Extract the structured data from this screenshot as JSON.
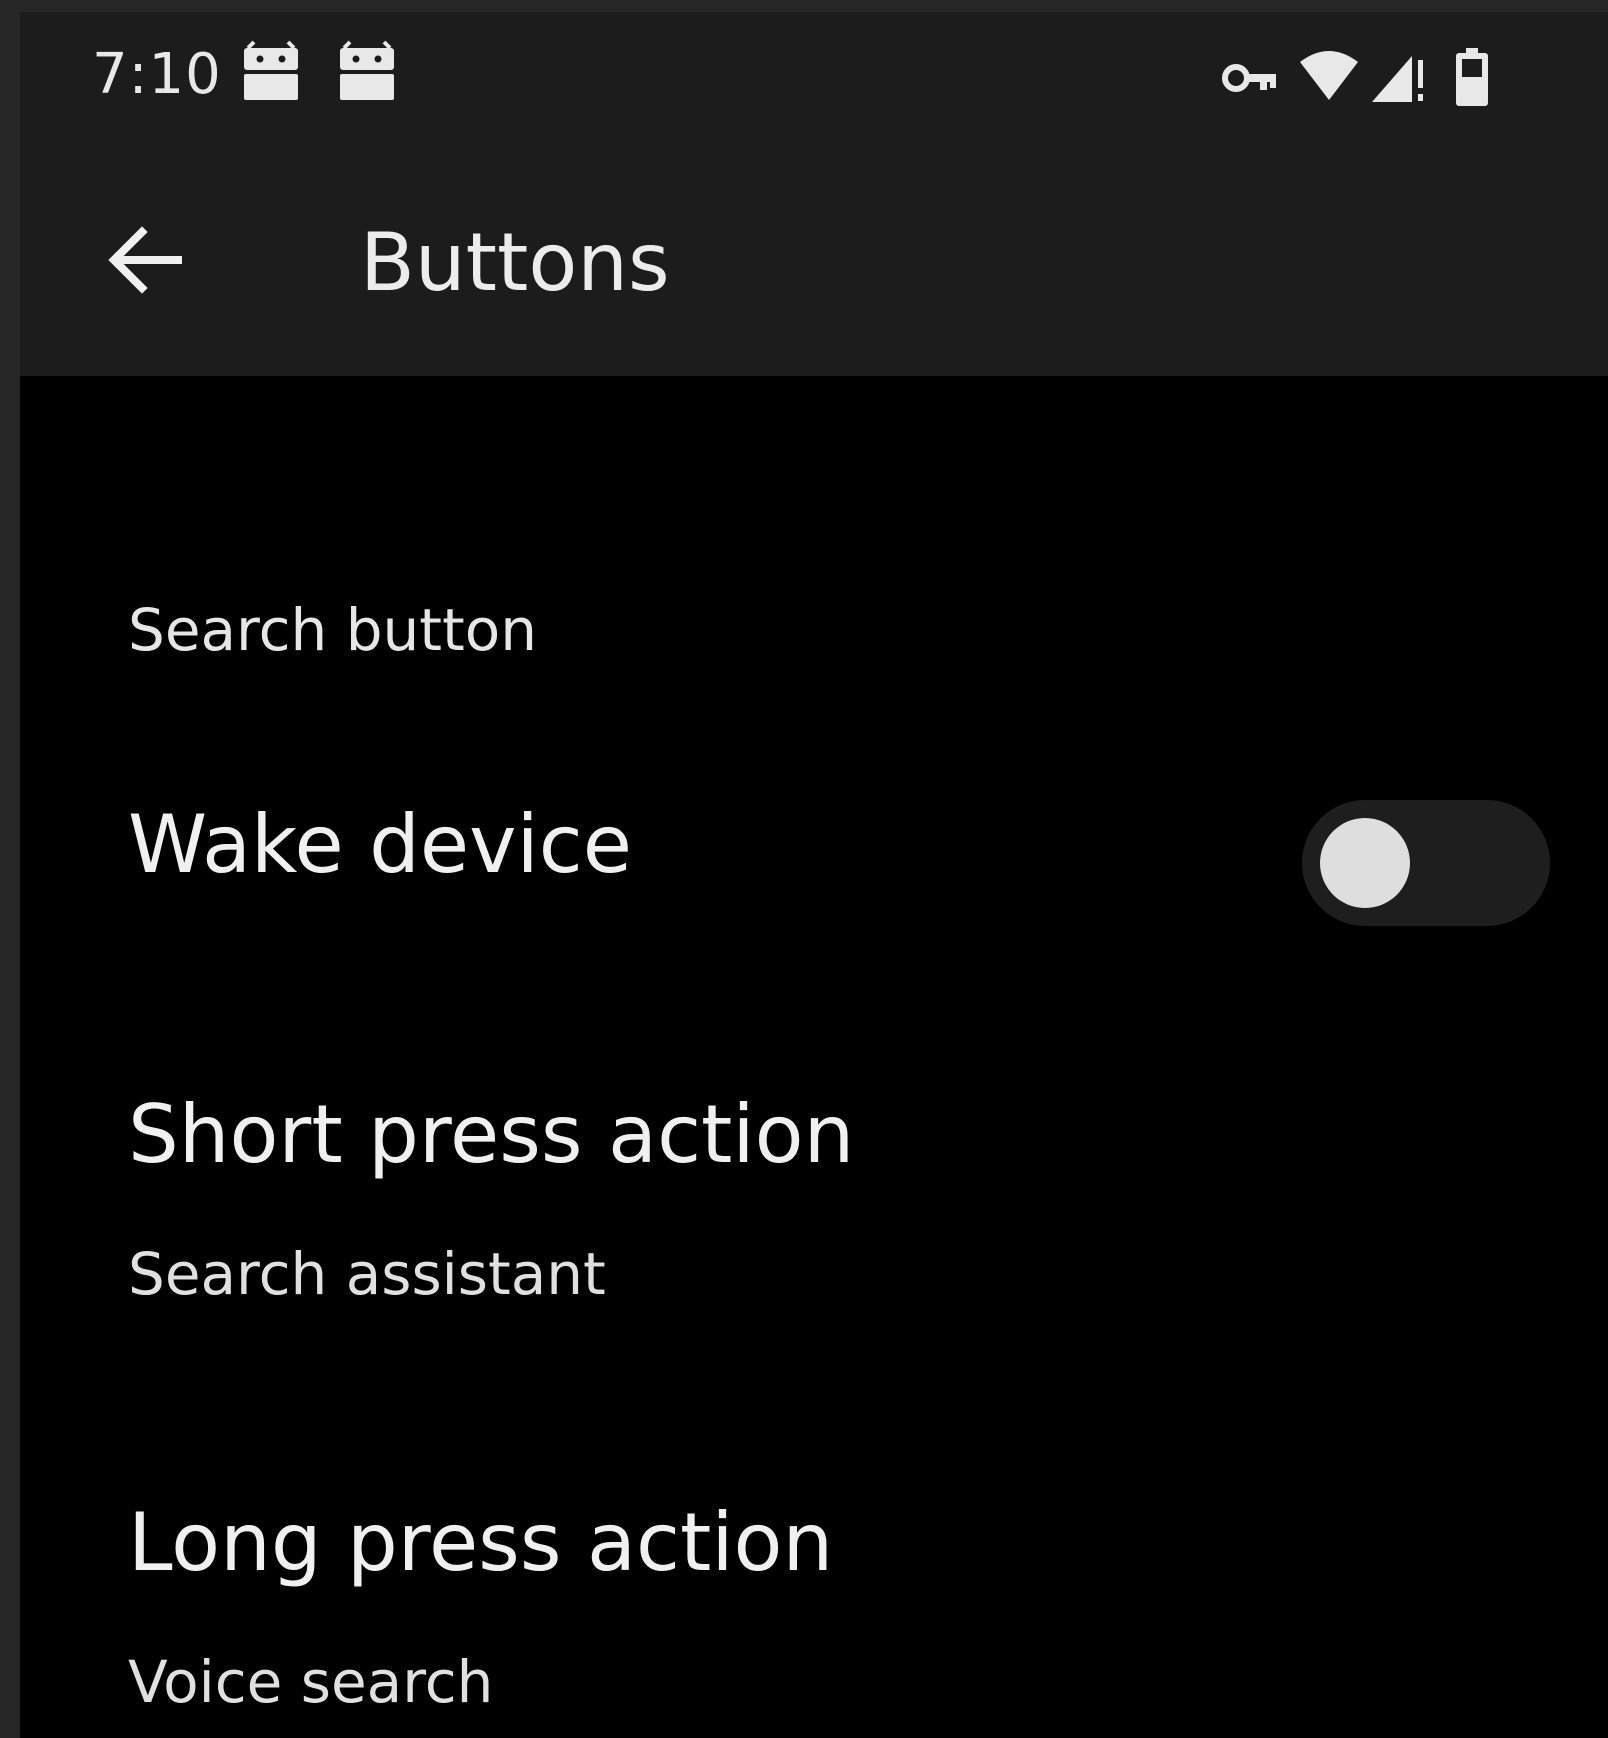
{
  "status_bar": {
    "time": "7:10",
    "notification_icons": [
      "android-icon",
      "android-icon"
    ],
    "system_icons": [
      "vpn-key-icon",
      "wifi-icon",
      "cell-signal-icon",
      "battery-icon"
    ]
  },
  "app_bar": {
    "back_icon": "arrow-back-icon",
    "title": "Buttons"
  },
  "settings": {
    "category": "Search button",
    "wake_device": {
      "title": "Wake device",
      "enabled": false
    },
    "short_press": {
      "title": "Short press action",
      "summary": "Search assistant"
    },
    "long_press": {
      "title": "Long press action",
      "summary": "Voice search"
    }
  },
  "colors": {
    "bar_background": "#1c1c1c",
    "screen_background": "#000000",
    "text": "#f0f0f0",
    "switch_thumb": "#dedede",
    "switch_track": "#1e1e1e"
  }
}
